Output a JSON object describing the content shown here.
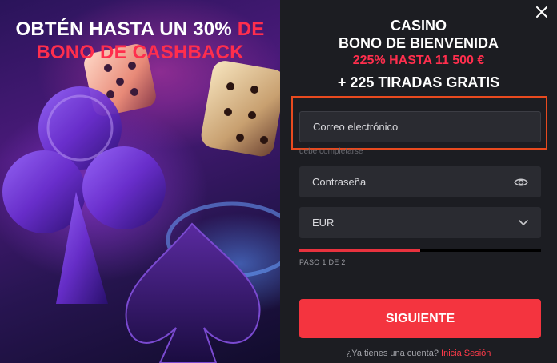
{
  "promo": {
    "title_white": "OBTÉN HASTA UN 30%",
    "title_red_1": "DE",
    "title_red_2": "BONO DE CASHBACK"
  },
  "panel": {
    "heading_line1": "CASINO",
    "heading_line2": "BONO DE BIENVENIDA",
    "heading_line3": "225% HASTA 11 500 €",
    "heading_line4": "+ 225 TIRADAS GRATIS"
  },
  "form": {
    "email_placeholder": "Correo electrónico",
    "email_hint": "debe completarse",
    "password_placeholder": "Contraseña",
    "currency_selected": "EUR",
    "progress_fraction": 0.5,
    "step_text": "PASO 1 DE 2",
    "next_label": "SIGUIENTE"
  },
  "footer": {
    "question": "¿Ya tienes una cuenta?",
    "login_link": "Inicia Sesión"
  },
  "colors": {
    "accent_red": "#f4343f",
    "highlight_orange": "#e84a1f",
    "panel_bg": "#1c1d22",
    "field_bg": "#2a2b31"
  },
  "icons": [
    "close-icon",
    "eye-icon",
    "chevron-down-icon",
    "dice-icon",
    "club-suit-icon",
    "spade-suit-icon"
  ]
}
